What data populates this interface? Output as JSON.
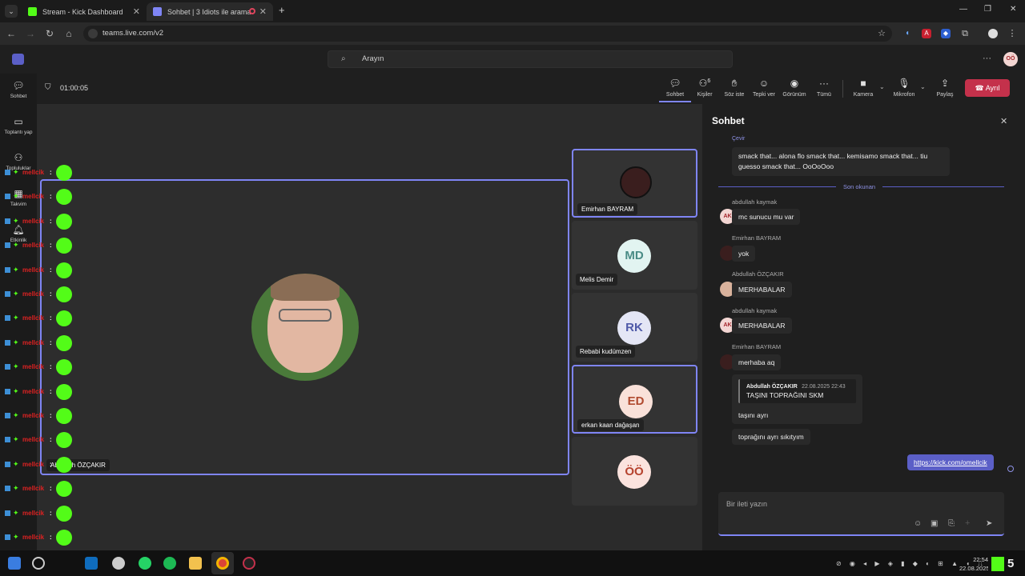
{
  "browser": {
    "tabs": [
      {
        "label": "Stream - Kick Dashboard",
        "active": false
      },
      {
        "label": "Sohbet | 3 Idiots ile arama y",
        "active": true
      }
    ],
    "url": "teams.live.com/v2",
    "new_tab": "+",
    "colors": {
      "kick": "#53fc18",
      "teams": "#7f85f5"
    }
  },
  "teams": {
    "search_placeholder": "Arayın",
    "more": "···",
    "user_initials": "OÖ",
    "rail": [
      {
        "label": "Sohbet",
        "icon": "chat-icon"
      },
      {
        "label": "Toplantı yap",
        "icon": "camera-icon"
      },
      {
        "label": "Topluluklar",
        "icon": "communities-icon"
      },
      {
        "label": "Takvim",
        "icon": "calendar-icon"
      },
      {
        "label": "Etkinlik",
        "icon": "bell-icon"
      }
    ]
  },
  "meeting": {
    "timer": "01:00:05",
    "toolbar": {
      "chat": "Sohbet",
      "people": "Kişiler",
      "people_count": "6",
      "raise": "Söz iste",
      "react": "Tepki ver",
      "view": "Görünüm",
      "more": "Tümü",
      "camera": "Kamera",
      "mic": "Mikrofon",
      "share": "Paylaş",
      "leave": "Ayrıl"
    },
    "main_speaker": "Abdullah ÖZÇAKIR",
    "tiles": [
      {
        "name": "Emirhan BAYRAM",
        "initials": "",
        "active": true
      },
      {
        "name": "Melis Demir",
        "initials": "MD",
        "active": false
      },
      {
        "name": "Rebabi kudümzen",
        "initials": "RK",
        "active": false
      },
      {
        "name": "erkan kaan dağaşan",
        "initials": "ED",
        "active": true
      },
      {
        "name": "",
        "initials": "ÖÖ",
        "active": false
      }
    ]
  },
  "kick_overlay": {
    "username": "mellcik",
    "separator": ":",
    "row_count": 16
  },
  "chat": {
    "title": "Sohbet",
    "close": "✕",
    "translate": "Çevir",
    "first_message": "smack that... alona flo smack that... kemisamo smack that... tiu guesso smack that... OoOoOoo",
    "last_read": "Son okunan",
    "messages": [
      {
        "sender": "abdullah kaymak",
        "initials": "AK",
        "text": "mc sunucu mu var"
      },
      {
        "sender": "Emirhan BAYRAM",
        "initials": "",
        "text": "yok"
      },
      {
        "sender": "Abdullah ÖZÇAKIR",
        "initials": "",
        "text": "MERHABALAR"
      },
      {
        "sender": "abdullah kaymak",
        "initials": "AK",
        "text": "MERHABALAR"
      },
      {
        "sender": "Emirhan BAYRAM",
        "initials": "",
        "text": "merhaba aq"
      }
    ],
    "quote": {
      "sender": "Abdullah ÖZÇAKIR",
      "time": "22.08.2025 22:43",
      "text": "TAŞINI TOPRAĞINI SKM"
    },
    "followups": [
      "taşını ayrı",
      "toprağını ayrı sıkıtyım"
    ],
    "own_message": "https://kick.com/omellcik",
    "compose_placeholder": "Bir ileti yazın"
  },
  "taskbar": {
    "time": "22:54",
    "date": "22.08.2025",
    "badge": "5"
  }
}
